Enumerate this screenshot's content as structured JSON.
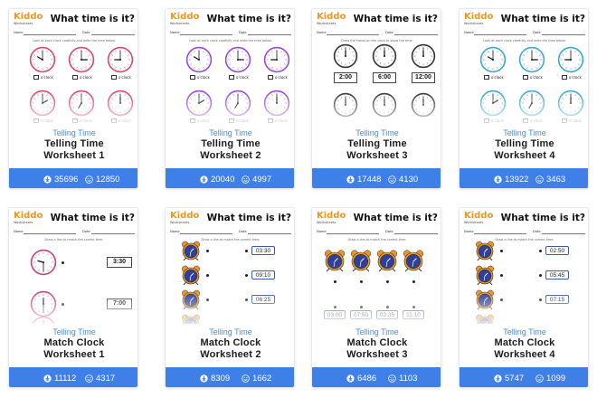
{
  "cards": [
    {
      "header_title": "What time is it?",
      "logo_text": "Kiddo",
      "logo_sub": "Worksheets",
      "name_label": "Name",
      "date_label": "Date",
      "instruction": "Look at each clock carefully and write the time below.",
      "category": "Telling Time",
      "title_line1": "Telling Time",
      "title_line2": "Worksheet 1",
      "downloads": "35696",
      "likes": "12850",
      "accent": "#e0456f",
      "kind": "analog",
      "oclock_label": "o'clock"
    },
    {
      "header_title": "What time is it?",
      "logo_text": "Kiddo",
      "logo_sub": "Worksheets",
      "name_label": "Name",
      "date_label": "Date",
      "instruction": "Look at each clock carefully and write the time below.",
      "category": "Telling Time",
      "title_line1": "Telling Time",
      "title_line2": "Worksheet 2",
      "downloads": "20040",
      "likes": "4997",
      "accent": "#9a4ad8",
      "kind": "analog",
      "oclock_label": "o'clock"
    },
    {
      "header_title": "What time is it?",
      "logo_text": "Kiddo",
      "logo_sub": "Worksheets",
      "name_label": "Name",
      "date_label": "Date",
      "instruction": "Draw the hands on the clock to show the time.",
      "category": "Telling Time",
      "title_line1": "Telling Time",
      "title_line2": "Worksheet 3",
      "downloads": "17448",
      "likes": "4130",
      "accent": "#333333",
      "kind": "draw",
      "times": [
        "2:00",
        "6:00",
        "12:00"
      ]
    },
    {
      "header_title": "What time is it?",
      "logo_text": "Kiddo",
      "logo_sub": "Worksheets",
      "name_label": "Name",
      "date_label": "Date",
      "instruction": "Look at each clock carefully and write the time below.",
      "category": "Telling Time",
      "title_line1": "Telling Time",
      "title_line2": "Worksheet 4",
      "downloads": "13922",
      "likes": "3463",
      "accent": "#3aaad0",
      "kind": "analog",
      "oclock_label": "o'clock"
    },
    {
      "header_title": "What time is it?",
      "logo_text": "Kiddo",
      "logo_sub": "Worksheets",
      "name_label": "Name",
      "date_label": "Date",
      "instruction": "Draw a line to match the correct time.",
      "category": "Telling Time",
      "title_line1": "Match Clock",
      "title_line2": "Worksheet 1",
      "downloads": "11112",
      "likes": "4317",
      "accent": "#c2457a",
      "kind": "match1",
      "times": [
        "3:30",
        "7:00"
      ]
    },
    {
      "header_title": "What time is it?",
      "logo_text": "Kiddo",
      "logo_sub": "Worksheets",
      "name_label": "Name",
      "date_label": "Date",
      "instruction": "Draw a line to match the correct time.",
      "category": "Telling Time",
      "title_line1": "Match Clock",
      "title_line2": "Worksheet 2",
      "downloads": "8309",
      "likes": "1662",
      "accent": "#e89a2a",
      "kind": "match2",
      "times": [
        "03:30",
        "09:10",
        "06:25"
      ]
    },
    {
      "header_title": "What time is it?",
      "logo_text": "Kiddo",
      "logo_sub": "Worksheets",
      "name_label": "Name",
      "date_label": "Date",
      "instruction": "Draw a line to match the correct time.",
      "category": "Telling Time",
      "title_line1": "Match Clock",
      "title_line2": "Worksheet 3",
      "downloads": "6486",
      "likes": "1103",
      "accent": "#e89a2a",
      "kind": "match3",
      "times": [
        "03:00",
        "07:50",
        "02:35",
        "11:10"
      ]
    },
    {
      "header_title": "What time is it?",
      "logo_text": "Kiddo",
      "logo_sub": "Worksheets",
      "name_label": "Name",
      "date_label": "Date",
      "instruction": "Draw a line to match the correct time.",
      "category": "Telling Time",
      "title_line1": "Match Clock",
      "title_line2": "Worksheet 4",
      "downloads": "5747",
      "likes": "1099",
      "accent": "#e89a2a",
      "kind": "match2",
      "times": [
        "02:50",
        "05:45",
        "07:15"
      ]
    }
  ],
  "colors": {
    "stats_bar": "#3f7fe8",
    "category_text": "#4a8ad8"
  },
  "icons": {
    "downloads": "download-icon",
    "likes": "smiley-icon"
  }
}
